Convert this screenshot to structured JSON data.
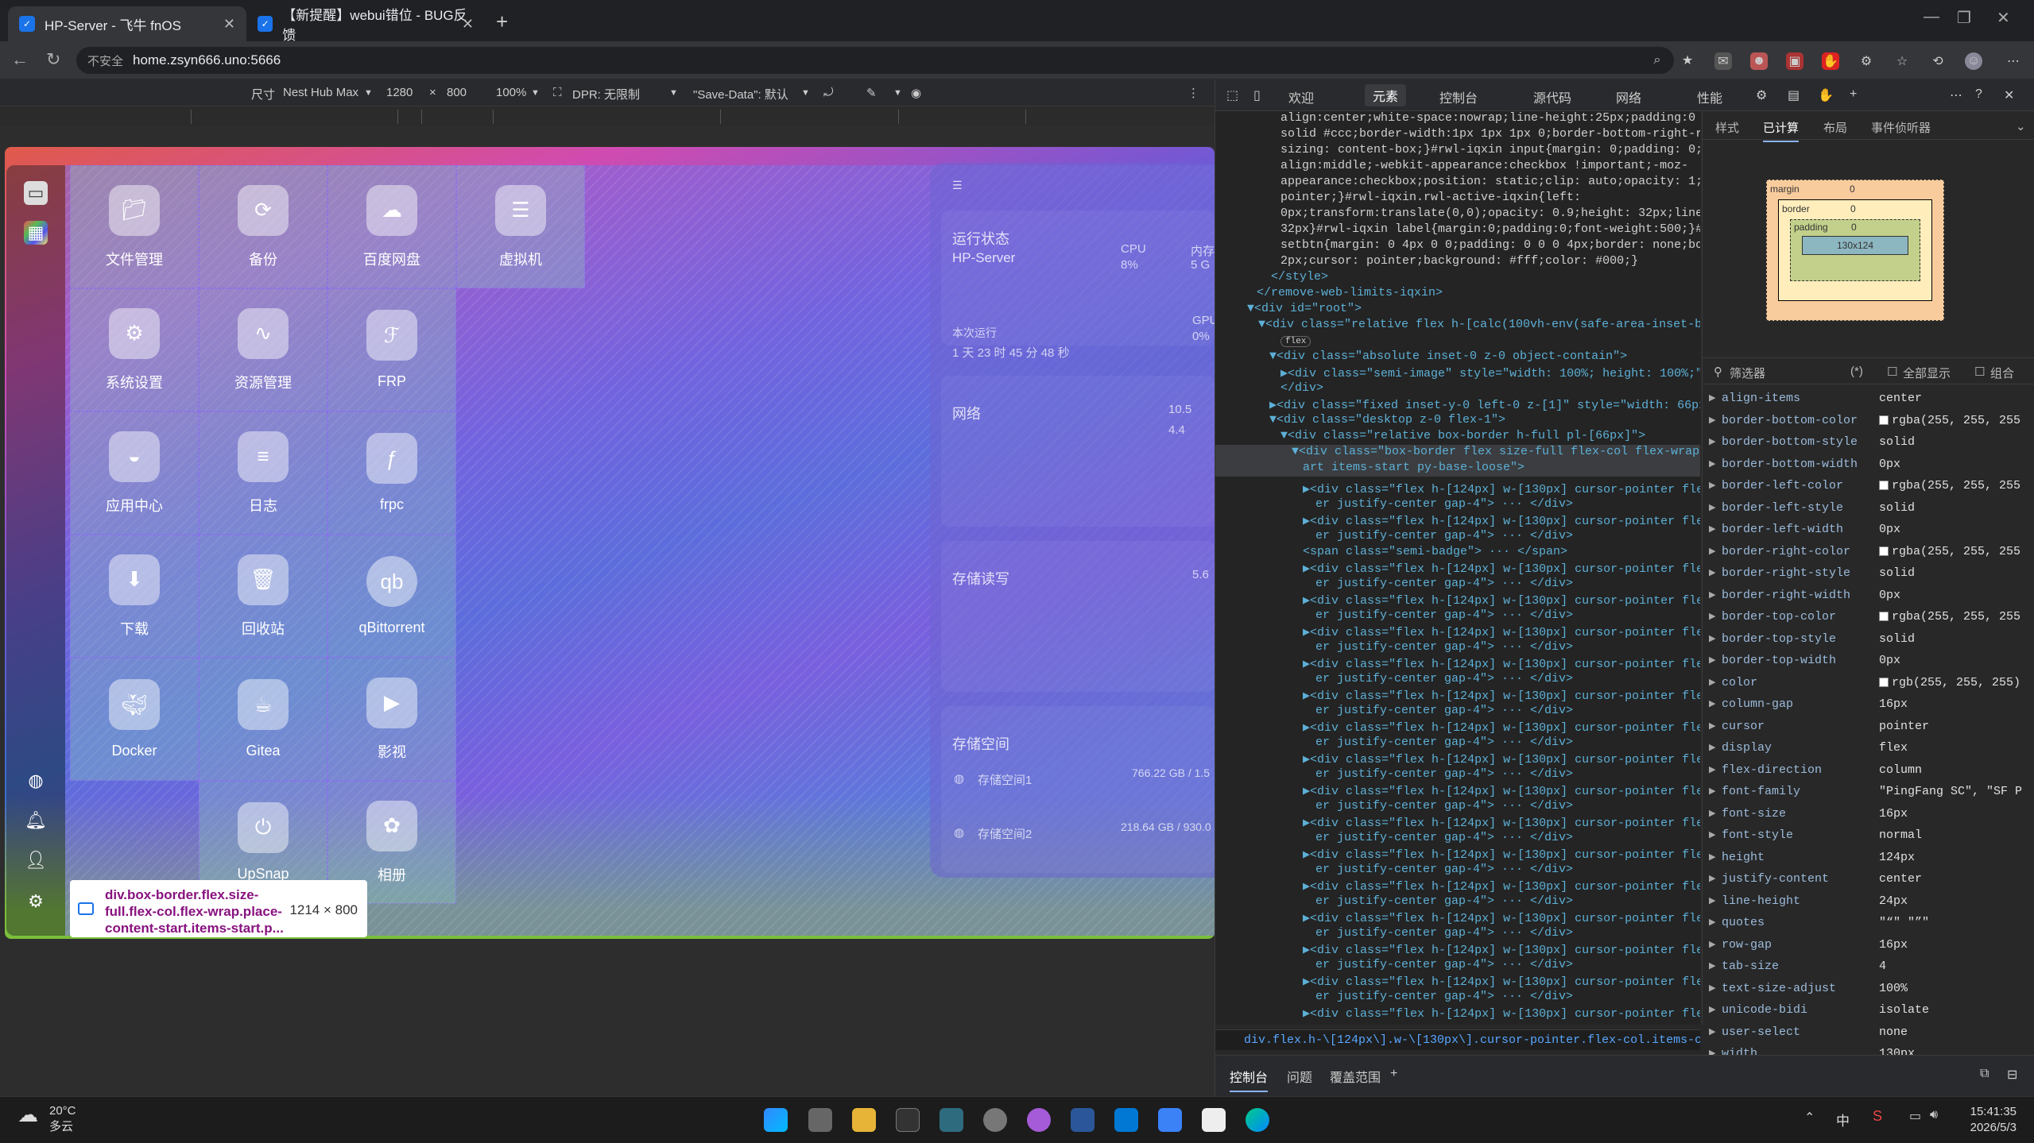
{
  "tabs": [
    {
      "title": "HP-Server - 飞牛 fnOS",
      "active": true
    },
    {
      "title": "【新提醒】webui错位 - BUG反馈",
      "active": false
    }
  ],
  "address": {
    "security": "不安全",
    "url": "home.zsyn666.uno:5666"
  },
  "device_toolbar": {
    "size_label": "尺寸",
    "device": "Nest Hub Max",
    "width": "1280",
    "times": "×",
    "height": "800",
    "zoom": "100%",
    "dpr": "DPR: 无限制",
    "save_data": "\"Save-Data\": 默认"
  },
  "apps": [
    {
      "label": "文件管理",
      "icon": "folder-icon"
    },
    {
      "label": "备份",
      "icon": "backup-icon"
    },
    {
      "label": "百度网盘",
      "icon": "baidu-icon"
    },
    {
      "label": "虚拟机",
      "icon": "vm-icon"
    },
    {
      "label": "系统设置",
      "icon": "gear-icon"
    },
    {
      "label": "资源管理",
      "icon": "monitor-icon"
    },
    {
      "label": "FRP",
      "icon": "frp-icon"
    },
    {
      "label": "应用中心",
      "icon": "store-icon"
    },
    {
      "label": "日志",
      "icon": "log-icon"
    },
    {
      "label": "frpc",
      "icon": "frpc-icon"
    },
    {
      "label": "下载",
      "icon": "download-icon"
    },
    {
      "label": "回收站",
      "icon": "trash-icon"
    },
    {
      "label": "qBittorrent",
      "icon": "qb-icon"
    },
    {
      "label": "Docker",
      "icon": "docker-icon"
    },
    {
      "label": "Gitea",
      "icon": "gitea-icon"
    },
    {
      "label": "影视",
      "icon": "video-icon"
    },
    {
      "label": "UpSnap",
      "icon": "upsnap-icon"
    },
    {
      "label": "相册",
      "icon": "photo-icon"
    }
  ],
  "status_panel": {
    "run_state": "运行状态",
    "host": "HP-Server",
    "cpu_label": "CPU",
    "cpu_value": "8%",
    "mem_label": "内存",
    "mem_value": "5 G",
    "uptime_label": "本次运行",
    "uptime": "1 天 23 时 45 分 48 秒",
    "gpu_label": "GPU",
    "gpu_value": "0%",
    "network": "网络",
    "net_up": "10.5",
    "net_down": "4.4",
    "disk_rw": "存储读写",
    "disk_rw_val": "5.6",
    "storage": "存储空间",
    "storage1_name": "存储空间1",
    "storage1_val": "766.22 GB / 1.5",
    "storage2_name": "存储空间2",
    "storage2_val": "218.64 GB / 930.0"
  },
  "tooltip": {
    "selector": "div.box-border.flex.size-full.flex-col.flex-wrap.place-content-start.items-start.p...",
    "size": "1214 × 800"
  },
  "devtools": {
    "tabs": [
      "欢迎",
      "元素",
      "控制台",
      "源代码",
      "网络",
      "性能"
    ],
    "active_tab": "元素",
    "subtabs": [
      "样式",
      "已计算",
      "布局",
      "事件侦听器"
    ],
    "active_subtab": "已计算",
    "box_model": {
      "margin": "margin",
      "border": "border",
      "padding": "padding",
      "content": "130x124",
      "zero": "0"
    },
    "filter": {
      "label": "筛选器",
      "show_all": "全部显示",
      "group": "组合"
    },
    "computed": [
      {
        "name": "align-items",
        "value": "center"
      },
      {
        "name": "border-bottom-color",
        "value": "rgba(255, 255, 255",
        "swatch": true
      },
      {
        "name": "border-bottom-style",
        "value": "solid"
      },
      {
        "name": "border-bottom-width",
        "value": "0px"
      },
      {
        "name": "border-left-color",
        "value": "rgba(255, 255, 255",
        "swatch": true
      },
      {
        "name": "border-left-style",
        "value": "solid"
      },
      {
        "name": "border-left-width",
        "value": "0px"
      },
      {
        "name": "border-right-color",
        "value": "rgba(255, 255, 255",
        "swatch": true
      },
      {
        "name": "border-right-style",
        "value": "solid"
      },
      {
        "name": "border-right-width",
        "value": "0px"
      },
      {
        "name": "border-top-color",
        "value": "rgba(255, 255, 255",
        "swatch": true
      },
      {
        "name": "border-top-style",
        "value": "solid"
      },
      {
        "name": "border-top-width",
        "value": "0px"
      },
      {
        "name": "color",
        "value": "rgb(255, 255, 255)",
        "swatch": true
      },
      {
        "name": "column-gap",
        "value": "16px"
      },
      {
        "name": "cursor",
        "value": "pointer"
      },
      {
        "name": "display",
        "value": "flex"
      },
      {
        "name": "flex-direction",
        "value": "column"
      },
      {
        "name": "font-family",
        "value": "\"PingFang SC\", \"SF P"
      },
      {
        "name": "font-size",
        "value": "16px"
      },
      {
        "name": "font-style",
        "value": "normal"
      },
      {
        "name": "height",
        "value": "124px"
      },
      {
        "name": "justify-content",
        "value": "center"
      },
      {
        "name": "line-height",
        "value": "24px"
      },
      {
        "name": "quotes",
        "value": "\"“\" \"”\""
      },
      {
        "name": "row-gap",
        "value": "16px"
      },
      {
        "name": "tab-size",
        "value": "4"
      },
      {
        "name": "text-size-adjust",
        "value": "100%"
      },
      {
        "name": "unicode-bidi",
        "value": "isolate"
      },
      {
        "name": "user-select",
        "value": "none"
      },
      {
        "name": "width",
        "value": "130px"
      }
    ],
    "css_lines": [
      "align:center;white-space:nowrap;line-height:25px;padding:0 16px",
      "solid #ccc;border-width:1px 1px 1px 0;border-bottom-right-radius",
      "sizing: content-box;}#rwl-iqxin input{margin: 0;padding: 0;t",
      "align:middle;-webkit-appearance:checkbox !important;-moz-",
      "appearance:checkbox;position: static;clip: auto;opacity: 1;curs",
      "pointer;}#rwl-iqxin.rwl-active-iqxin{left:",
      "0px;transform:translate(0,0);opacity: 0.9;height: 32px;line-hei",
      "32px}#rwl-iqxin label{margin:0;padding:0;font-weight:500;}#rwl-",
      "setbtn{margin: 0 4px 0 0;padding: 0 0 0 4px;border: none;border",
      "2px;cursor: pointer;background: #fff;color: #000;}"
    ],
    "dom_lines": [
      "</style>",
      "</remove-web-limits-iqxin>",
      "▼<div id=\"root\">",
      "▼<div class=\"relative flex h-[calc(100vh-env(safe-area-inset-botto",
      "▼<div class=\"absolute inset-0 z-0 object-contain\">",
      "▶<div class=\"semi-image\" style=\"width: 100%; height: 100%;\">",
      "</div>",
      "▶<div class=\"fixed inset-y-0 left-0 z-[1]\" style=\"width: 66px;\">",
      "▼<div class=\"desktop z-0 flex-1\">",
      "▼<div class=\"relative box-border h-full pl-[66px]\">",
      "▼<div class=\"box-border flex size-full flex-col flex-wrap pl",
      "art items-start py-base-loose\">",
      "<span class=\"semi-badge\"> ··· </span>",
      "div.flex.h-\\[124px\\].w-\\[130px\\].cursor-pointer.flex-col.items-center.justify-center.ga"
    ],
    "item_line_a": "▶<div class=\"flex h-[124px] w-[130px] cursor-pointer flex-",
    "item_line_b": "er justify-center gap-4\"> ··· </div>",
    "flex_badge": "flex",
    "drawer": [
      "控制台",
      "问题",
      "覆盖范围"
    ]
  },
  "taskbar": {
    "temp": "20°C",
    "weather": "多云",
    "time": "15:41:35",
    "date": "2026/5/3",
    "ime": "中"
  }
}
